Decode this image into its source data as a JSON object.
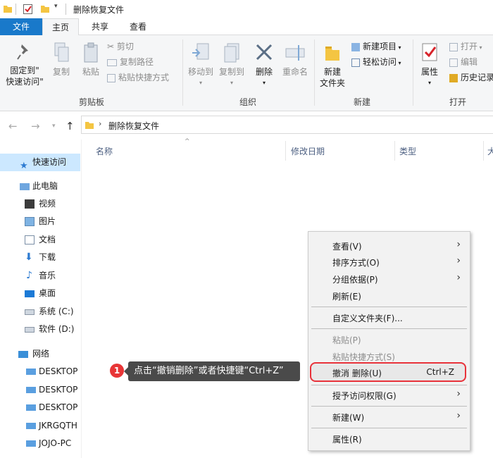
{
  "window": {
    "title": "删除恢复文件"
  },
  "tabs": {
    "file": "文件",
    "home": "主页",
    "share": "共享",
    "view": "查看"
  },
  "ribbon": {
    "clipboard": {
      "pin_line1": "固定到\"",
      "pin_line2": "快速访问\"",
      "copy": "复制",
      "paste": "粘贴",
      "cut": "剪切",
      "copy_path": "复制路径",
      "paste_shortcut": "粘贴快捷方式",
      "label": "剪贴板"
    },
    "organize": {
      "move_to": "移动到",
      "copy_to": "复制到",
      "delete": "删除",
      "rename": "重命名",
      "label": "组织"
    },
    "new": {
      "new_folder_line1": "新建",
      "new_folder_line2": "文件夹",
      "new_item": "新建项目",
      "easy_access": "轻松访问",
      "label": "新建"
    },
    "open": {
      "properties": "属性",
      "open": "打开",
      "edit": "编辑",
      "history": "历史记录",
      "label": "打开"
    }
  },
  "address": {
    "path": "删除恢复文件"
  },
  "columns": {
    "name": "名称",
    "modified": "修改日期",
    "type": "类型",
    "size": "大"
  },
  "nav": {
    "quick_access": "快速访问",
    "this_pc": "此电脑",
    "items": [
      "视频",
      "图片",
      "文档",
      "下载",
      "音乐",
      "桌面",
      "系统 (C:)",
      "软件 (D:)"
    ],
    "network": "网络",
    "network_items": [
      "DESKTOP",
      "DESKTOP",
      "DESKTOP",
      "JKRGQTH",
      "JOJO-PC"
    ]
  },
  "context_menu": {
    "view": "查看(V)",
    "sort": "排序方式(O)",
    "group": "分组依据(P)",
    "refresh": "刷新(E)",
    "customize": "自定义文件夹(F)...",
    "paste": "粘贴(P)",
    "paste_shortcut": "粘贴快捷方式(S)",
    "undo": "撤消 删除(U)",
    "undo_shortcut": "Ctrl+Z",
    "grant_access": "授予访问权限(G)",
    "new": "新建(W)",
    "properties": "属性(R)"
  },
  "callout": {
    "number": "1",
    "text": "点击“撤销删除”或者快捷键“Ctrl+Z”"
  },
  "colors": {
    "accent": "#1979ca",
    "highlight_red": "#e8323a",
    "selected_bg": "#cce8ff"
  }
}
